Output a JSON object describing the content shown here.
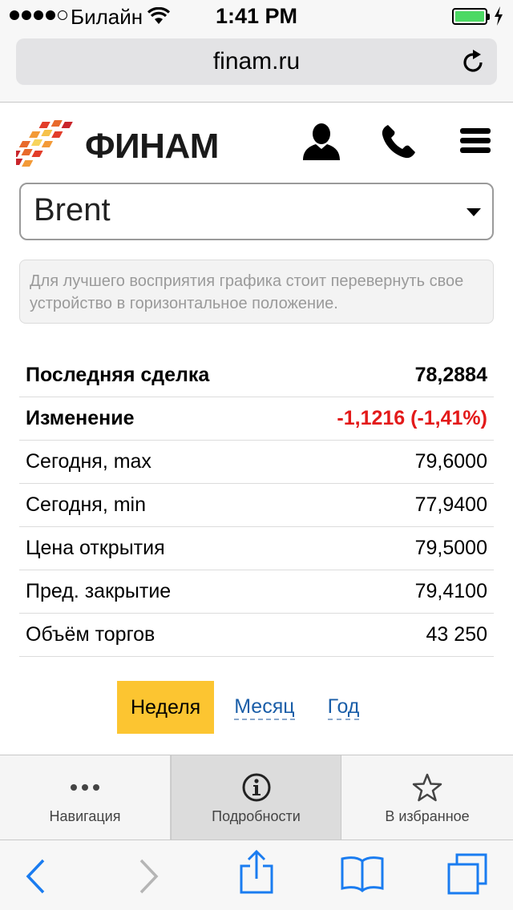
{
  "status_bar": {
    "carrier": "Билайн",
    "time": "1:41 PM",
    "battery_level": 1.0
  },
  "address_bar": {
    "url": "finam.ru"
  },
  "site_header": {
    "logo_text": "ФИНАМ"
  },
  "instrument_select": {
    "selected": "Brent"
  },
  "hint": {
    "text": "Для лучшего восприятия графика стоит перевернуть свое устройство в горизонтальное положение."
  },
  "quote_table": {
    "rows": [
      {
        "label": "Последняя сделка",
        "value": "78,2884"
      },
      {
        "label": "Изменение",
        "value": "-1,1216 (-1,41%)"
      },
      {
        "label": "Сегодня, max",
        "value": "79,6000"
      },
      {
        "label": "Сегодня, min",
        "value": "77,9400"
      },
      {
        "label": "Цена открытия",
        "value": "79,5000"
      },
      {
        "label": "Пред. закрытие",
        "value": "79,4100"
      },
      {
        "label": "Объём торгов",
        "value": "43 250"
      }
    ]
  },
  "period_tabs": {
    "items": [
      {
        "label": "Неделя",
        "active": true
      },
      {
        "label": "Месяц",
        "active": false
      },
      {
        "label": "Год",
        "active": false
      }
    ]
  },
  "site_tabbar": {
    "items": [
      {
        "label": "Навигация",
        "icon": "more-dots-icon"
      },
      {
        "label": "Подробности",
        "icon": "info-icon",
        "active": true
      },
      {
        "label": "В избранное",
        "icon": "star-icon"
      }
    ]
  },
  "colors": {
    "negative": "#e31a1a",
    "active_tab": "#fcc531",
    "link": "#1a5ea8",
    "ios_blue": "#1a7cf0"
  }
}
